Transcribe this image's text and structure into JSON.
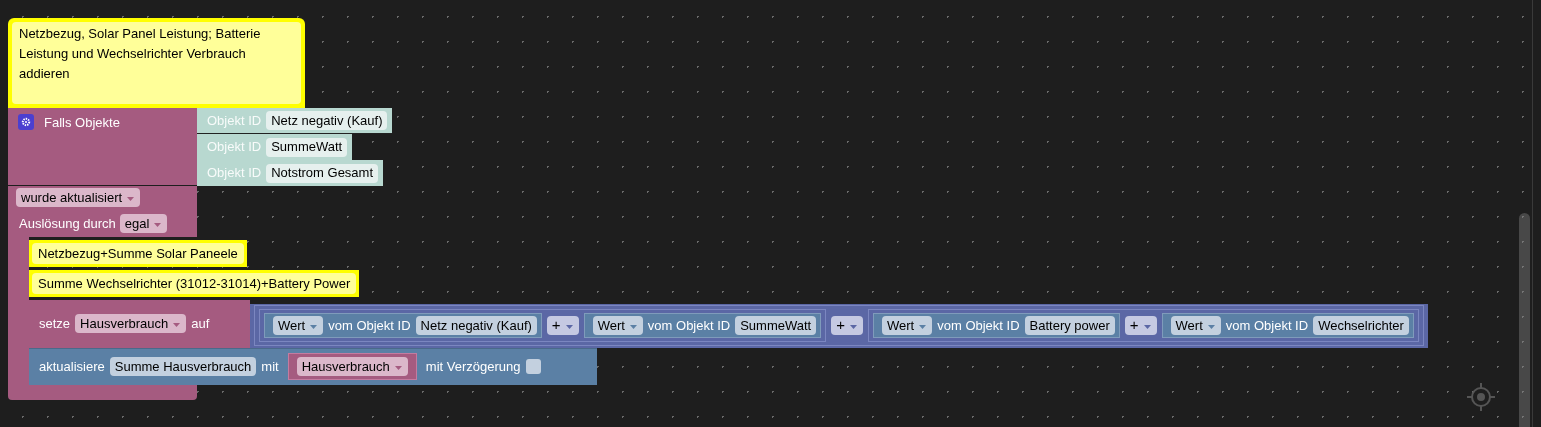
{
  "top_comment": {
    "text": "Netzbezug, Solar Panel Leistung; Batterie Leistung und Wechselrichter Verbrauch addieren"
  },
  "event_block": {
    "label": "Falls Objekte",
    "objects": [
      {
        "prefix": "Objekt ID",
        "value": "Netz negativ (Kauf)"
      },
      {
        "prefix": "Objekt ID",
        "value": "SummeWatt"
      },
      {
        "prefix": "Objekt ID",
        "value": "Notstrom Gesamt"
      }
    ],
    "condition": "wurde aktualisiert",
    "trigger_label": "Auslösung durch",
    "trigger": "egal"
  },
  "statements": [
    {
      "kind": "comment",
      "text": "Netzbezug+Summe Solar Paneele"
    },
    {
      "kind": "comment",
      "text": "Summe Wechselrichter (31012-31014)+Battery Power"
    },
    {
      "kind": "set",
      "label": "setze",
      "variable": "Hausverbrauch",
      "to_label": "auf",
      "value": {
        "kind": "sum",
        "operator": "+",
        "operands": [
          {
            "kind": "sum",
            "operator": "+",
            "operands": [
              {
                "kind": "value",
                "mode": "Wert",
                "label": "vom Objekt ID",
                "object": "Netz negativ (Kauf)"
              },
              {
                "kind": "value",
                "mode": "Wert",
                "label": "vom Objekt ID",
                "object": "SummeWatt"
              }
            ]
          },
          {
            "kind": "sum",
            "operator": "+",
            "operands": [
              {
                "kind": "value",
                "mode": "Wert",
                "label": "vom Objekt ID",
                "object": "Battery power"
              },
              {
                "kind": "value",
                "mode": "Wert",
                "label": "vom Objekt ID",
                "object": "Wechselrichter"
              }
            ]
          }
        ]
      }
    },
    {
      "kind": "update",
      "label": "aktualisiere",
      "target": "Summe Hausverbrauch",
      "with_label": "mit",
      "variable": "Hausverbrauch",
      "delay_label": "mit Verzögerung",
      "delay": false
    }
  ]
}
